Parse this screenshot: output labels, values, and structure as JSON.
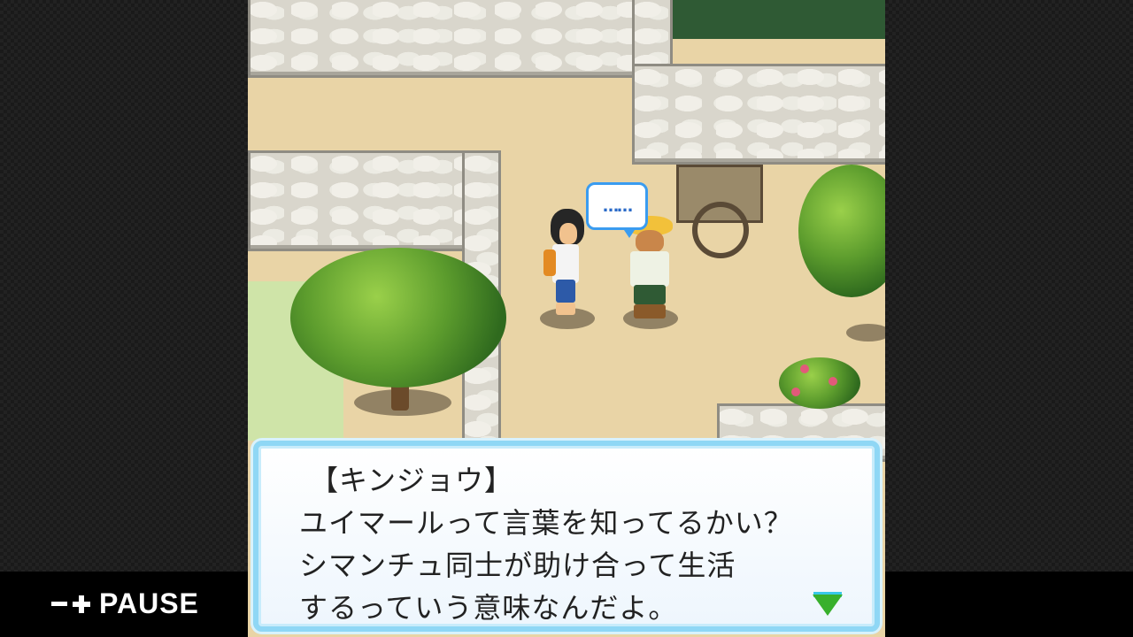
{
  "overlay": {
    "pause_label": "PAUSE",
    "minus_icon": "minus-icon",
    "plus_icon": "plus-icon"
  },
  "scene": {
    "speech_bubble_text": "……"
  },
  "dialog": {
    "speaker": "【キンジョウ】",
    "lines": [
      "ユイマールって言葉を知ってるかい？",
      "シマンチュ同士が助け合って生活",
      "するっていう意味なんだよ。"
    ],
    "next_indicator_icon": "down-triangle-icon"
  },
  "colors": {
    "dialog_border": "#8fd7f5",
    "speech_border": "#3a9cf0",
    "next_arrow": "#38b02c"
  }
}
